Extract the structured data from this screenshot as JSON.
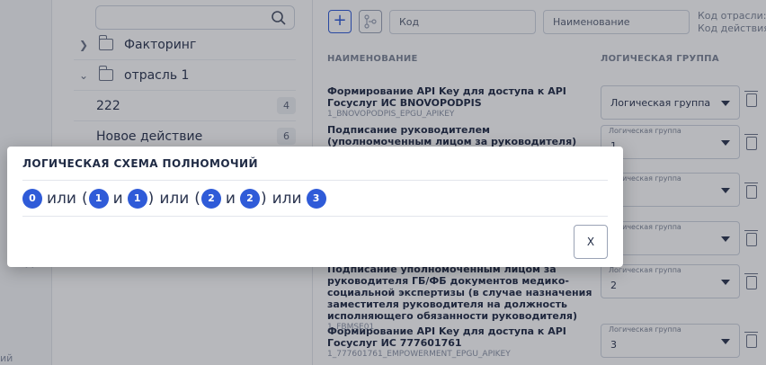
{
  "tree": {
    "search_placeholder": "",
    "items": [
      {
        "label": "Факторинг",
        "expanded": false,
        "type": "folder"
      },
      {
        "label": "отрасль 1",
        "expanded": true,
        "type": "folder"
      },
      {
        "label": "222",
        "count": "4",
        "type": "leaf"
      },
      {
        "label": "Новое действие",
        "count": "6",
        "type": "leaf"
      }
    ],
    "bottom_text": "ий"
  },
  "toolbar": {
    "add_label": "+",
    "filter_code_placeholder": "Код",
    "filter_name_placeholder": "Наименование",
    "meta_line1": "Код отрасли: о",
    "meta_line2": "Код действия:"
  },
  "table": {
    "col_name": "НАИМЕНОВАНИЕ",
    "col_group": "ЛОГИЧЕСКАЯ ГРУППА",
    "rows": [
      {
        "title": "Формирование API Key для доступа к API Госуслуг ИС BNOVOPODPIS",
        "code": "1_BNOVOPODPIS_EPGU_APIKEY",
        "select_label": "",
        "select_value": "Логическая группа"
      },
      {
        "title": "Подписание руководителем (уполномоченным лицом за руководителя) экспертного состава документов медико-",
        "code": "",
        "select_label": "Логическая группа",
        "select_value": "1"
      },
      {
        "title": "",
        "code": "",
        "select_label": "Логическая группа",
        "select_value": ""
      },
      {
        "title": "",
        "code": "",
        "select_label": "Логическая группа",
        "select_value": ""
      },
      {
        "title": "Подписание уполномоченным лицом за руководителя ГБ/ФБ документов медико-социальной экспертизы (в случае назначения заместителя руководителя на должность исполняющего обязанности руководителя)",
        "code": "1_FBMSE01",
        "select_label": "Логическая группа",
        "select_value": "2"
      },
      {
        "title": "Формирование API Key для доступа к API Госуслуг ИС 777601761",
        "code": "1_777601761_EMPOWERMENT_EPGU_APIKEY",
        "select_label": "Логическая группа",
        "select_value": "3"
      }
    ]
  },
  "modal": {
    "title": "ЛОГИЧЕСКАЯ СХЕМА ПОЛНОМОЧИЙ",
    "formula": {
      "c0": "0",
      "or1": "или",
      "open1": "(",
      "c1": "1",
      "and1": "и",
      "c2": "1",
      "close1": ")",
      "or2": "или",
      "open2": "(",
      "c3": "2",
      "and2": "и",
      "c4": "2",
      "close2": ")",
      "or3": "или",
      "c5": "3"
    },
    "close_label": "X"
  },
  "colors": {
    "accent": "#2f5bd8",
    "overlay": "rgba(30,34,48,0.32)"
  }
}
